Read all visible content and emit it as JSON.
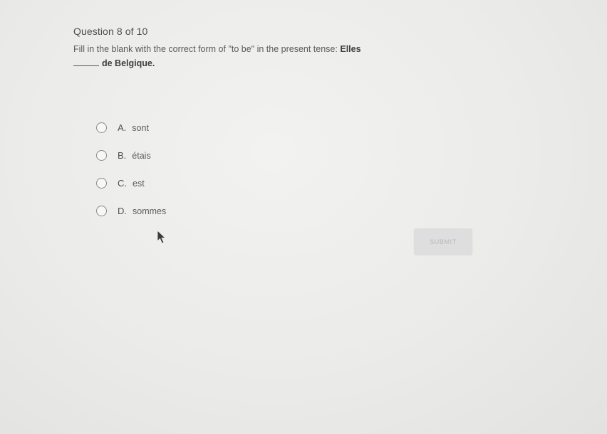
{
  "quiz": {
    "counter": "Question 8 of 10",
    "prompt": "Fill in the blank with the correct form of \"to be\" in the present tense:",
    "sentence_start": "Elles",
    "sentence_end": "de Belgique.",
    "options": [
      {
        "letter": "A.",
        "text": "sont"
      },
      {
        "letter": "B.",
        "text": "étais"
      },
      {
        "letter": "C.",
        "text": "est"
      },
      {
        "letter": "D.",
        "text": "sommes"
      }
    ],
    "submit_label": "SUBMIT"
  }
}
